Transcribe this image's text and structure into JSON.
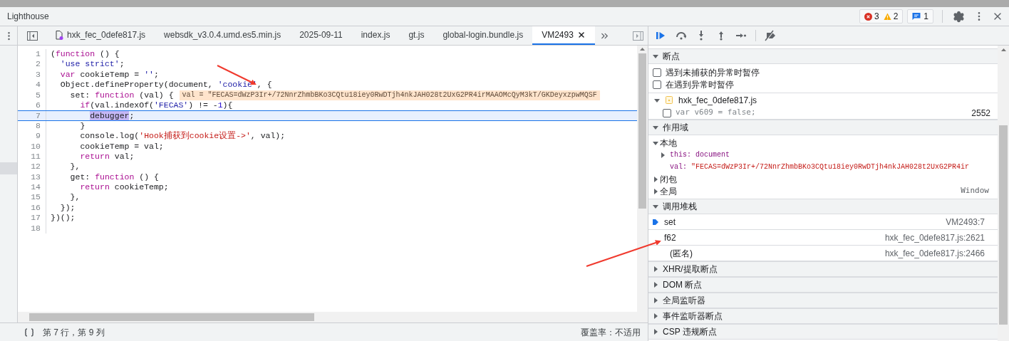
{
  "top_bar": {
    "title": "Lighthouse",
    "errors": "3",
    "warnings": "2",
    "messages": "1"
  },
  "editor_tabs": [
    {
      "label": "hxk_fec_0defe817.js",
      "selected": false,
      "has_icon": true
    },
    {
      "label": "websdk_v3.0.4.umd.es5.min.js",
      "selected": false,
      "has_icon": false
    },
    {
      "label": "2025-09-11",
      "selected": false,
      "has_icon": false
    },
    {
      "label": "index.js",
      "selected": false,
      "has_icon": false
    },
    {
      "label": "gt.js",
      "selected": false,
      "has_icon": false
    },
    {
      "label": "global-login.bundle.js",
      "selected": false,
      "has_icon": false
    },
    {
      "label": "VM2493",
      "selected": true,
      "has_icon": false
    }
  ],
  "code": {
    "lines": [
      {
        "number": "1",
        "current": false,
        "tokens": [
          {
            "kind": "plain",
            "text": "("
          },
          {
            "kind": "keyword",
            "text": "function"
          },
          {
            "kind": "plain",
            "text": " () {"
          }
        ]
      },
      {
        "number": "2",
        "current": false,
        "tokens": [
          {
            "kind": "string",
            "text": "  'use strict'"
          },
          {
            "kind": "plain",
            "text": ";"
          }
        ]
      },
      {
        "number": "3",
        "current": false,
        "tokens": [
          {
            "kind": "keyword",
            "text": "  var"
          },
          {
            "kind": "plain",
            "text": " cookieTemp = "
          },
          {
            "kind": "string",
            "text": "''"
          },
          {
            "kind": "plain",
            "text": ";"
          }
        ]
      },
      {
        "number": "4",
        "current": false,
        "tokens": [
          {
            "kind": "plain",
            "text": "  Object.defineProperty(document, "
          },
          {
            "kind": "string",
            "text": "'cookie'"
          },
          {
            "kind": "plain",
            "text": ", {"
          }
        ]
      },
      {
        "number": "5",
        "current": false,
        "inline_value": "val = \"FECAS=dWzP3Ir+/72NnrZhmbBKo3CQtu18iey0RwDTjh4nkJAH028t2UxG2PR4irMAAOMcQyM3kT/GKDeyxzpwMQSF",
        "tokens": [
          {
            "kind": "plain",
            "text": "    set: "
          },
          {
            "kind": "keyword",
            "text": "function"
          },
          {
            "kind": "plain",
            "text": " (val) {"
          }
        ]
      },
      {
        "number": "6",
        "current": false,
        "tokens": [
          {
            "kind": "keyword",
            "text": "      if"
          },
          {
            "kind": "plain",
            "text": "(val.indexOf("
          },
          {
            "kind": "string",
            "text": "'FECAS'"
          },
          {
            "kind": "plain",
            "text": ") != -"
          },
          {
            "kind": "number",
            "text": "1"
          },
          {
            "kind": "plain",
            "text": "){"
          }
        ]
      },
      {
        "number": "7",
        "current": true,
        "tokens": [
          {
            "kind": "paused",
            "text": "        debugger"
          },
          {
            "kind": "plain",
            "text": ";"
          }
        ]
      },
      {
        "number": "8",
        "current": false,
        "tokens": [
          {
            "kind": "plain",
            "text": "      }"
          }
        ]
      },
      {
        "number": "9",
        "current": false,
        "tokens": [
          {
            "kind": "plain",
            "text": "      console.log("
          },
          {
            "kind": "message",
            "text": "'Hook捕获到cookie设置->'"
          },
          {
            "kind": "plain",
            "text": ", val);"
          }
        ]
      },
      {
        "number": "10",
        "current": false,
        "tokens": [
          {
            "kind": "plain",
            "text": "      cookieTemp = val;"
          }
        ]
      },
      {
        "number": "11",
        "current": false,
        "tokens": [
          {
            "kind": "keyword",
            "text": "      return"
          },
          {
            "kind": "plain",
            "text": " val;"
          }
        ]
      },
      {
        "number": "12",
        "current": false,
        "tokens": [
          {
            "kind": "plain",
            "text": "    },"
          }
        ]
      },
      {
        "number": "13",
        "current": false,
        "tokens": [
          {
            "kind": "plain",
            "text": "    get: "
          },
          {
            "kind": "keyword",
            "text": "function"
          },
          {
            "kind": "plain",
            "text": " () {"
          }
        ]
      },
      {
        "number": "14",
        "current": false,
        "tokens": [
          {
            "kind": "keyword",
            "text": "      return"
          },
          {
            "kind": "plain",
            "text": " cookieTemp;"
          }
        ]
      },
      {
        "number": "15",
        "current": false,
        "tokens": [
          {
            "kind": "plain",
            "text": "    },"
          }
        ]
      },
      {
        "number": "16",
        "current": false,
        "tokens": [
          {
            "kind": "plain",
            "text": "  });"
          }
        ]
      },
      {
        "number": "17",
        "current": false,
        "tokens": [
          {
            "kind": "plain",
            "text": "})();"
          }
        ]
      },
      {
        "number": "18",
        "current": false
      }
    ]
  },
  "status_bar": {
    "position": "第 7 行，第 9 列",
    "coverage": "覆盖率：不适用"
  },
  "sidebar_sections": [
    {
      "kind": "breakpoints",
      "title": "断点",
      "expanded": true,
      "options": [
        {
          "label": "遇到未捕获的异常时暂停",
          "checked": false
        },
        {
          "label": "在遇到异常时暂停",
          "checked": false
        }
      ],
      "files": [
        {
          "name": "hxk_fec_0defe817.js",
          "expanded": true,
          "breakpoints": [
            {
              "code": "var v609 = false;",
              "line": "2552",
              "checked": false
            }
          ]
        }
      ]
    },
    {
      "kind": "scope",
      "title": "作用域",
      "expanded": true,
      "scopes": [
        {
          "name": "本地",
          "expanded": true,
          "variables": [
            {
              "name": "this:",
              "value": "document",
              "kind": "object",
              "expandable": true
            },
            {
              "name": "val:",
              "value": "\"FECAS=dWzP3Ir+/72NnrZhmbBKo3CQtu18iey0RwDTjh4nkJAH028t2UxG2PR4ir",
              "kind": "string",
              "expandable": false
            }
          ]
        },
        {
          "name": "闭包",
          "expanded": false
        },
        {
          "name": "全局",
          "expanded": false,
          "value": "Window"
        }
      ]
    },
    {
      "kind": "call_stack",
      "title": "调用堆栈",
      "expanded": true,
      "frames": [
        {
          "name": "set",
          "location": "VM2493:7",
          "selected": true
        },
        {
          "name": "f62",
          "location": "hxk_fec_0defe817.js:2621",
          "selected": false
        },
        {
          "name": "(匿名)",
          "location": "hxk_fec_0defe817.js:2466",
          "selected": false
        }
      ]
    },
    {
      "title": "XHR/提取断点",
      "expanded": false
    },
    {
      "title": "DOM 断点",
      "expanded": false
    },
    {
      "title": "全局监听器",
      "expanded": false
    },
    {
      "title": "事件监听器断点",
      "expanded": false
    },
    {
      "title": "CSP 违规断点",
      "expanded": false
    }
  ]
}
